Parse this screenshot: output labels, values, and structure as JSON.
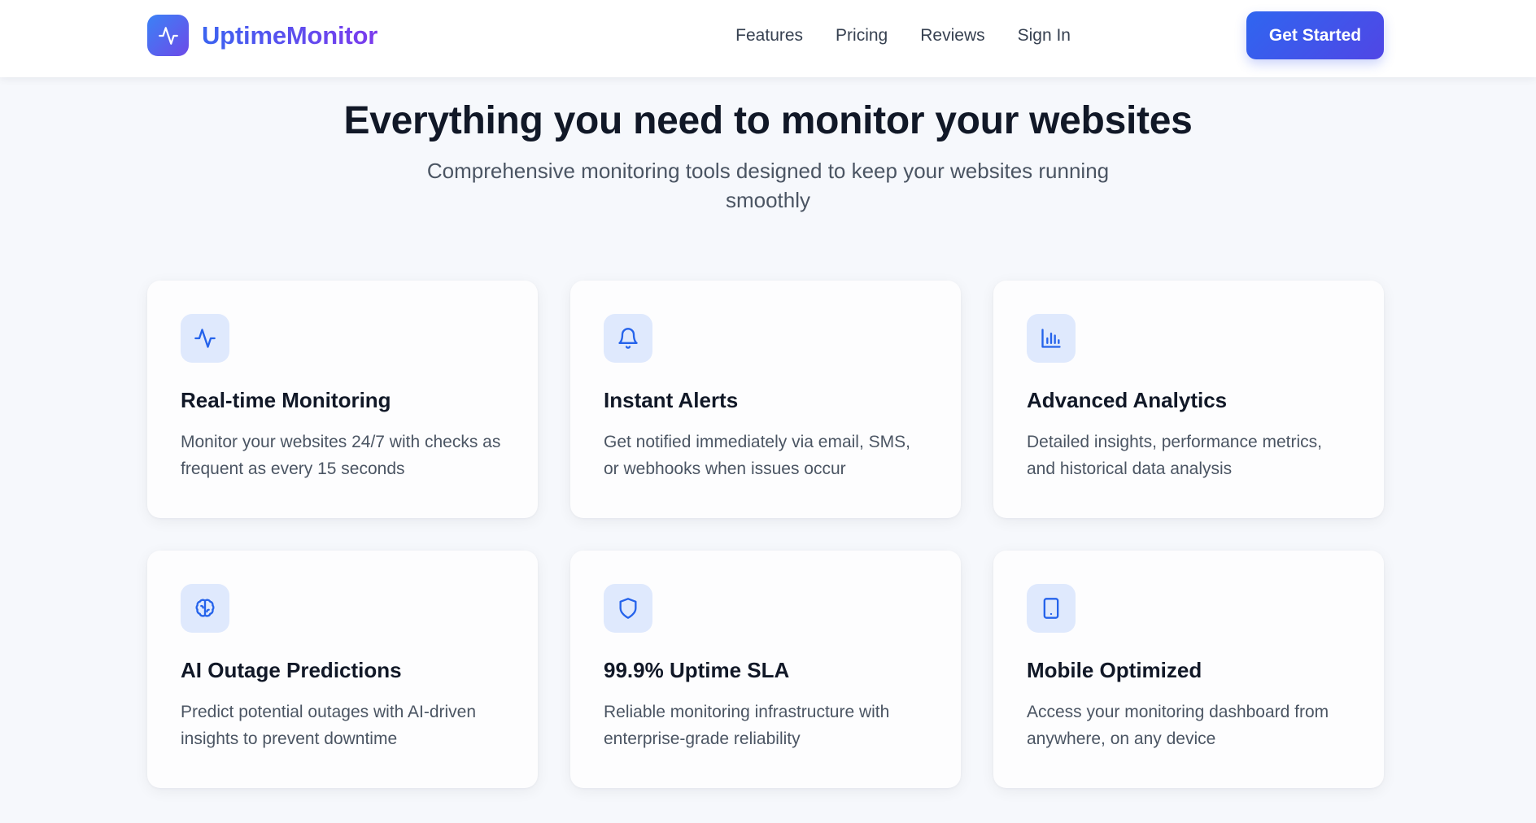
{
  "navbar": {
    "brand": {
      "name": "UptimeMonitor",
      "logo_icon": "activity-icon"
    },
    "links": [
      {
        "label": "Features"
      },
      {
        "label": "Pricing"
      },
      {
        "label": "Reviews"
      },
      {
        "label": "Sign In"
      }
    ],
    "cta_label": "Get Started"
  },
  "hero": {
    "title": "Everything you need to monitor your websites",
    "subtitle": "Comprehensive monitoring tools designed to keep your websites running smoothly"
  },
  "features": [
    {
      "icon": "activity-icon",
      "title": "Real-time Monitoring",
      "description": "Monitor your websites 24/7 with checks as frequent as every 15 seconds"
    },
    {
      "icon": "bell-icon",
      "title": "Instant Alerts",
      "description": "Get notified immediately via email, SMS, or webhooks when issues occur"
    },
    {
      "icon": "bar-chart-icon",
      "title": "Advanced Analytics",
      "description": "Detailed insights, performance metrics, and historical data analysis"
    },
    {
      "icon": "brain-icon",
      "title": "AI Outage Predictions",
      "description": "Predict potential outages with AI-driven insights to prevent downtime"
    },
    {
      "icon": "shield-icon",
      "title": "99.9% Uptime SLA",
      "description": "Reliable monitoring infrastructure with enterprise-grade reliability"
    },
    {
      "icon": "smartphone-icon",
      "title": "Mobile Optimized",
      "description": "Access your monitoring dashboard from anywhere, on any device"
    }
  ],
  "colors": {
    "brand_gradient_start": "#3b64f0",
    "brand_gradient_end": "#7c3aed",
    "cta_gradient_start": "#2f66f0",
    "cta_gradient_end": "#5046e5",
    "icon_color": "#2563eb",
    "icon_background": "#dfe9fd",
    "page_background": "#f6f8fc"
  }
}
